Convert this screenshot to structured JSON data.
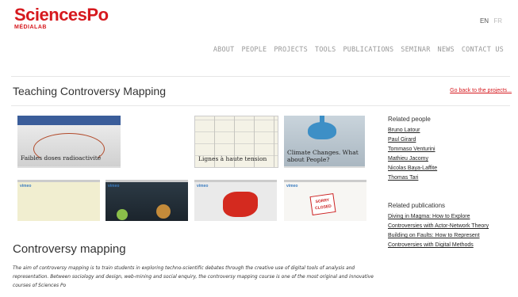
{
  "header": {
    "logo_main": "SciencesPo",
    "logo_sub": "MÉDIALAB",
    "lang_active": "EN",
    "lang_inactive": "FR"
  },
  "nav": {
    "items": [
      "ABOUT",
      "PEOPLE",
      "PROJECTS",
      "TOOLS",
      "PUBLICATIONS",
      "SEMINAR",
      "NEWS",
      "CONTACT US"
    ]
  },
  "page": {
    "title": "Teaching Controversy Mapping",
    "back_link": "Go back to the projects..."
  },
  "thumbnails": [
    {
      "caption": "Faibles doses radioactivité"
    },
    {
      "caption": "Lignes à haute tension"
    },
    {
      "caption": "Climate Changes. What about People?"
    }
  ],
  "videos": {
    "brand": "vimeo",
    "sign_text": "SORRY CLOSED"
  },
  "sidebar": {
    "people_heading": "Related people",
    "people": [
      "Bruno Latour",
      "Paul Girard",
      "Tommaso Venturini",
      "Mathieu Jacomy",
      "Nicolas Baya-Laffite",
      "Thomas Tari"
    ],
    "pubs_heading": "Related publications",
    "pubs": [
      "Diving in Magma: How to Explore",
      "Controversies with Actor-Network Theory",
      "Building on Faults: How to Represent",
      "Controversies with Digital Methods"
    ]
  },
  "content": {
    "section_title": "Controversy mapping",
    "intro": "The aim of controversy mapping is to train students in exploring techno-scientific debates through the creative use of digital tools of analysis and representation. Between sociology and design, web-mining and social enquiry, the controversy mapping course is one of the most original and innovative courses of Sciences Po"
  },
  "colors": {
    "brand": "#d6191e"
  }
}
